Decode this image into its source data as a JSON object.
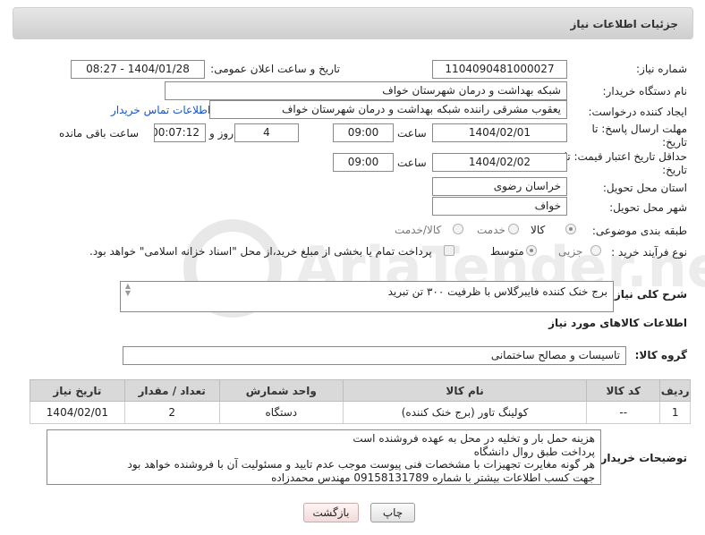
{
  "panel": {
    "title": "جزئیات اطلاعات نیاز"
  },
  "fields": {
    "need_number_label": "شماره نیاز:",
    "need_number": "1104090481000027",
    "announce_label": "تاریخ و ساعت اعلان عمومی:",
    "announce_value": "1404/01/28 - 08:27",
    "buyer_org_label": "نام دستگاه خریدار:",
    "buyer_org": "شبکه بهداشت و درمان شهرستان خواف",
    "creator_label": "ایجاد کننده درخواست:",
    "creator": "یعقوب مشرقی راننده شبکه بهداشت و درمان شهرستان خواف",
    "buyer_contact_link": "اطلاعات تماس خریدار",
    "deadline_label": "مهلت ارسال پاسخ: تا تاریخ:",
    "deadline_date": "1404/02/01",
    "time_label": "ساعت",
    "deadline_time": "09:00",
    "days_value": "4",
    "days_label": "روز و",
    "remaining_time": "00:07:12",
    "remaining_label": "ساعت باقی مانده",
    "validity_label": "حداقل تاریخ اعتبار قیمت: تا تاریخ:",
    "validity_date": "1404/02/02",
    "validity_time": "09:00",
    "province_label": "استان محل تحویل:",
    "province": "خراسان رضوی",
    "city_label": "شهر محل تحویل:",
    "city": "خواف",
    "category_label": "طبقه بندی موضوعی:",
    "category_options": [
      "کالا",
      "خدمت",
      "کالا/خدمت"
    ],
    "process_label": "نوع فرآیند خرید :",
    "process_options": [
      "جزیی",
      "متوسط"
    ],
    "payment_note": "پرداخت تمام یا بخشی از مبلغ خرید،از محل \"اسناد خزانه اسلامی\" خواهد بود."
  },
  "description": {
    "label": "شرح کلی نیاز:",
    "value": "برج خنک کننده فایبرگلاس با ظرفیت ۳۰۰ تن تبرید"
  },
  "goods_section": {
    "title": "اطلاعات کالاهای مورد نیاز"
  },
  "goods_group": {
    "label": "گروه کالا:",
    "value": "تاسیسات و مصالح ساختمانی"
  },
  "table": {
    "headers": [
      "ردیف",
      "کد کالا",
      "نام کالا",
      "واحد شمارش",
      "تعداد / مقدار",
      "تاریخ نیاز"
    ],
    "rows": [
      [
        "1",
        "--",
        "کولینگ تاور (برج خنک کننده)",
        "دستگاه",
        "2",
        "1404/02/01"
      ]
    ]
  },
  "buyer_notes": {
    "label": "توضیحات خریدار:",
    "lines": [
      "هزینه حمل بار و تخلیه در محل به عهده فروشنده است",
      "پرداخت طبق روال دانشگاه",
      "هر گونه مغایرت تجهیزات با مشخصات فنی پیوست موجب عدم تایید و مسئولیت آن با فروشنده خواهد بود",
      "جهت کسب اطلاعات بیشتر با شماره 09158131789 مهندس محمدزاده"
    ]
  },
  "buttons": {
    "print": "چاپ",
    "back": "بازگشت"
  },
  "watermark": {
    "text": "AriaTender.neT"
  },
  "colors": {
    "link": "#1a55c4",
    "header_bg": "#d9d9d9",
    "back_button": "#f2dada"
  }
}
